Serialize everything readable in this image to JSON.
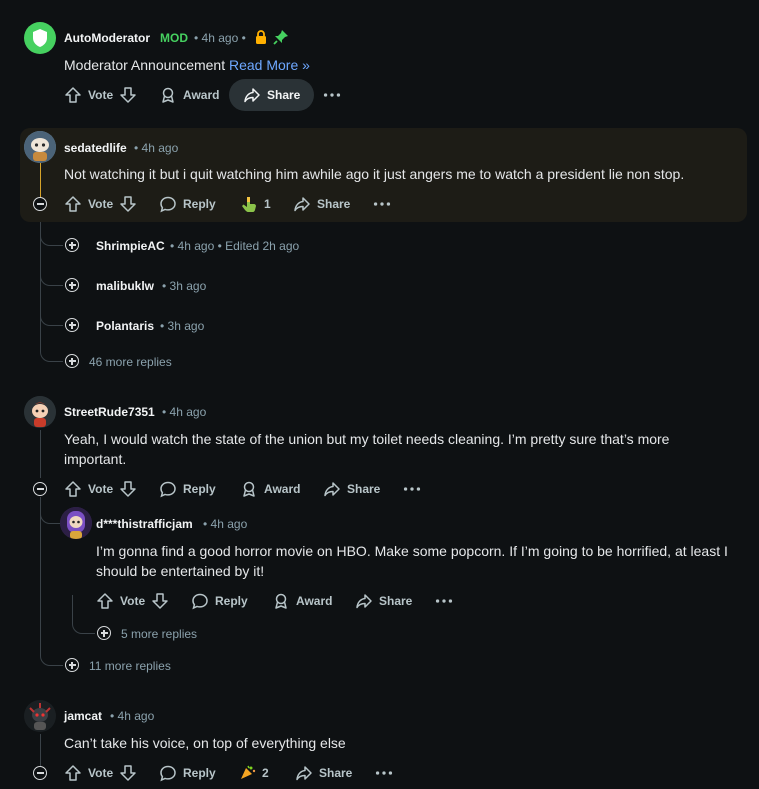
{
  "comments": [
    {
      "username": "AutoModerator",
      "mod_badge": "MOD",
      "time": "• 4h ago •",
      "text": "Moderator Announcement",
      "link": "Read More »",
      "vote": "Vote",
      "award": "Award",
      "share": "Share"
    },
    {
      "username": "sedatedlife",
      "time": "• 4h ago",
      "text": "Not watching it but i quit watching him awhile ago it just angers me to watch a president lie non stop.",
      "vote": "Vote",
      "reply": "Reply",
      "award_count": "1",
      "share": "Share"
    },
    {
      "username": "ShrimpieAC",
      "time": "• 4h ago • Edited 2h ago"
    },
    {
      "username": "malibuklw",
      "time": "• 3h ago"
    },
    {
      "username": "Polantaris",
      "time": "• 3h ago"
    },
    {
      "more_replies": "46 more replies"
    },
    {
      "username": "StreetRude7351",
      "time": "• 4h ago",
      "text_line1": "Yeah, I would watch the state of the union but my toilet needs cleaning. I’m pretty sure that’s more",
      "text_line2": "important.",
      "vote": "Vote",
      "reply": "Reply",
      "award": "Award",
      "share": "Share"
    },
    {
      "username": "d***thistrafficjam",
      "time": "• 4h ago",
      "text_line1": "I’m gonna find a good horror movie on HBO. Make some popcorn. If I’m going to be horrified, at least I",
      "text_line2": "should be entertained by it!",
      "vote": "Vote",
      "reply": "Reply",
      "award": "Award",
      "share": "Share"
    },
    {
      "more_replies": "5 more replies"
    },
    {
      "more_replies": "11 more replies"
    },
    {
      "username": "jamcat",
      "time": "• 4h ago",
      "text": "Can’t take his voice, on top of everything else",
      "vote": "Vote",
      "reply": "Reply",
      "award_count": "2",
      "share": "Share"
    }
  ],
  "icons": {
    "upvote": "arrow-up-icon",
    "downvote": "arrow-down-icon",
    "reply": "speech-bubble-icon",
    "award": "award-icon",
    "share": "share-arrow-icon",
    "more": "ellipsis-icon",
    "expand": "plus-circle-icon",
    "collapse": "minus-circle-icon",
    "lock": "lock-icon",
    "pin": "pin-icon"
  },
  "colors": {
    "background": "#0e1113",
    "mod_green": "#46d160",
    "link_blue": "#6ea8ff",
    "highlight": "#1d1c16",
    "lock": "#ffb000"
  }
}
